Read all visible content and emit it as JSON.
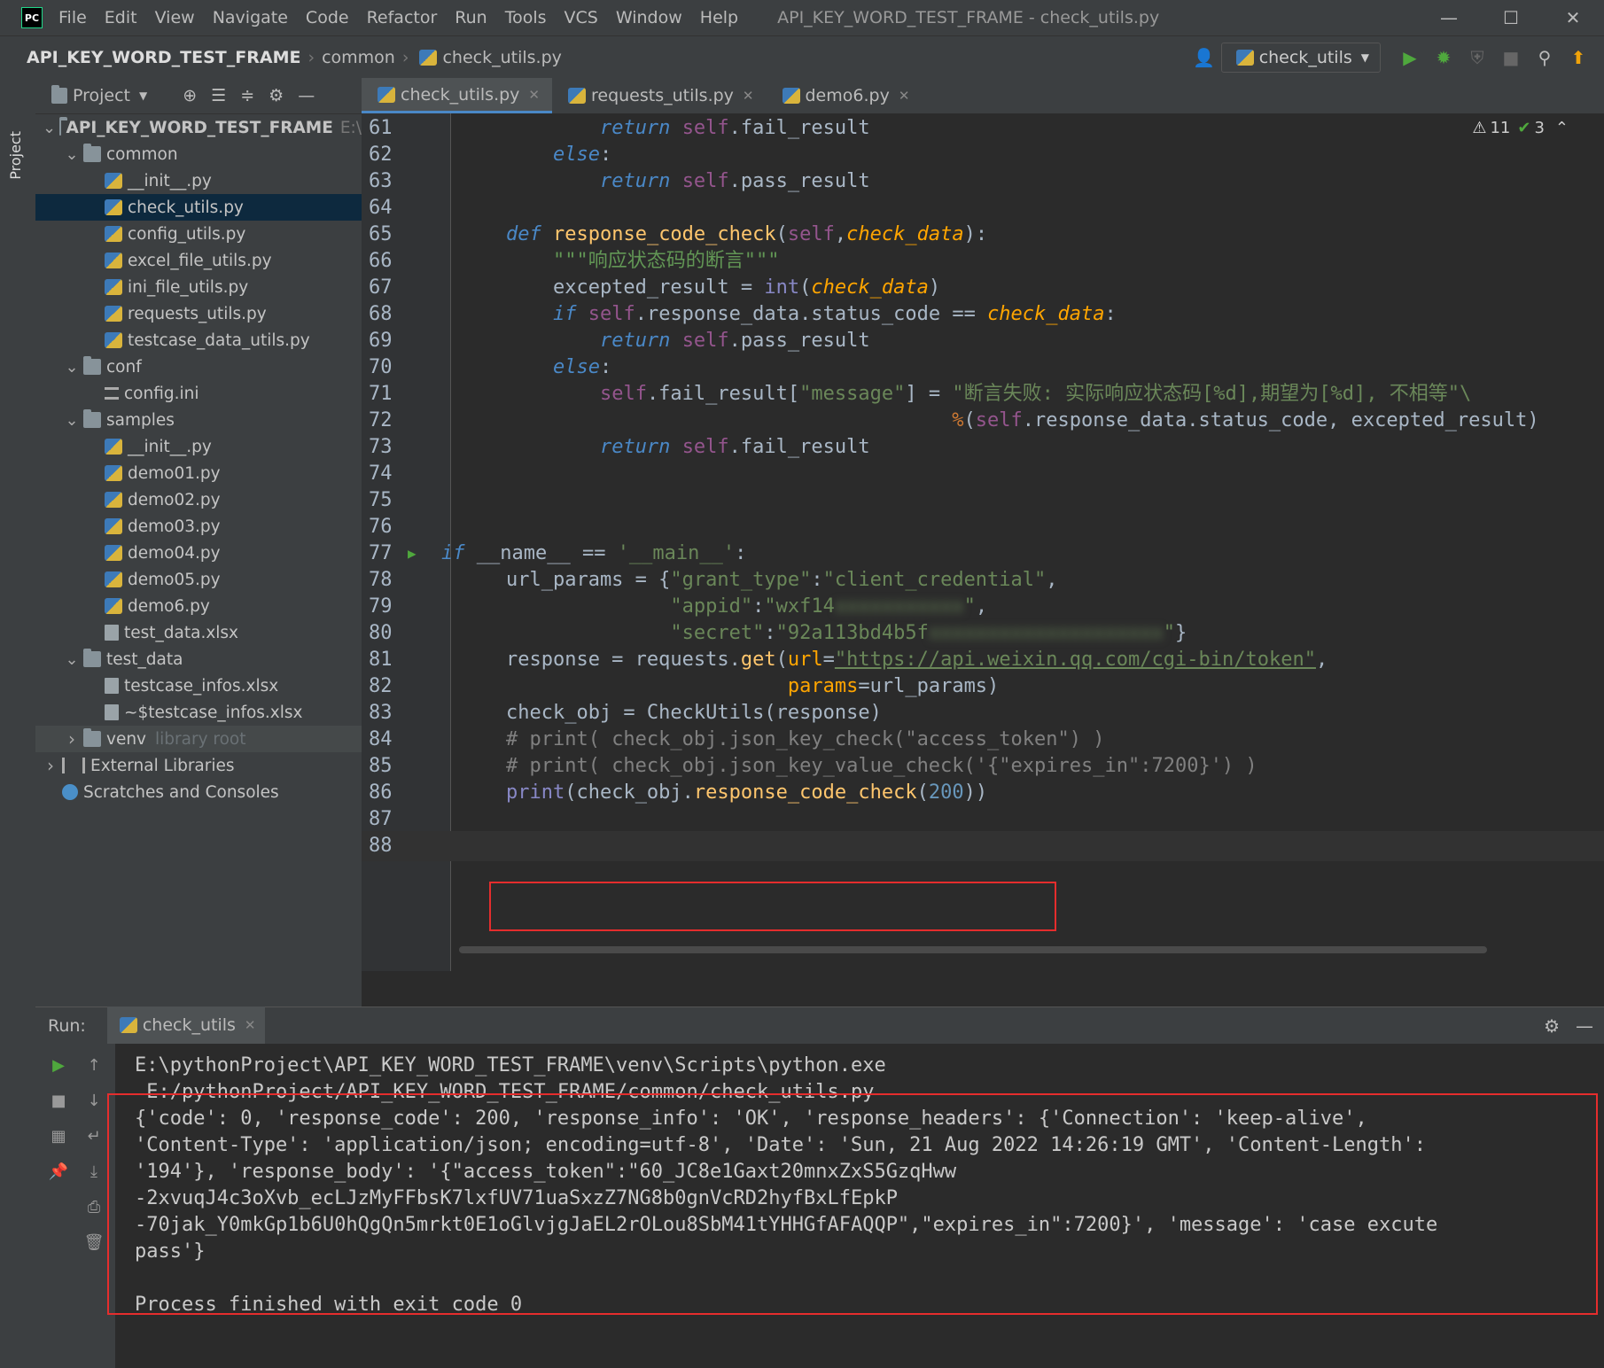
{
  "titlebar": {
    "logo": "PC",
    "menu": [
      "File",
      "Edit",
      "View",
      "Navigate",
      "Code",
      "Refactor",
      "Run",
      "Tools",
      "VCS",
      "Window",
      "Help"
    ],
    "title": "API_KEY_WORD_TEST_FRAME - check_utils.py",
    "controls": [
      "—",
      "☐",
      "✕"
    ]
  },
  "navbar": {
    "breadcrumb": [
      "API_KEY_WORD_TEST_FRAME",
      "common",
      "check_utils.py"
    ],
    "run_config": "check_utils"
  },
  "stripe": {
    "project_label": "Project"
  },
  "project_panel": {
    "title": "Project",
    "root_path_hint": "E:\\",
    "tree": [
      {
        "label": "API_KEY_WORD_TEST_FRAME",
        "type": "folder",
        "depth": 0,
        "open": true
      },
      {
        "label": "common",
        "type": "folder",
        "depth": 1,
        "open": true
      },
      {
        "label": "__init__.py",
        "type": "py",
        "depth": 2
      },
      {
        "label": "check_utils.py",
        "type": "py",
        "depth": 2,
        "selected": true
      },
      {
        "label": "config_utils.py",
        "type": "py",
        "depth": 2
      },
      {
        "label": "excel_file_utils.py",
        "type": "py",
        "depth": 2
      },
      {
        "label": "ini_file_utils.py",
        "type": "py",
        "depth": 2
      },
      {
        "label": "requests_utils.py",
        "type": "py",
        "depth": 2
      },
      {
        "label": "testcase_data_utils.py",
        "type": "py",
        "depth": 2
      },
      {
        "label": "conf",
        "type": "folder",
        "depth": 1,
        "open": true
      },
      {
        "label": "config.ini",
        "type": "ini",
        "depth": 2
      },
      {
        "label": "samples",
        "type": "folder",
        "depth": 1,
        "open": true
      },
      {
        "label": "__init__.py",
        "type": "py",
        "depth": 2
      },
      {
        "label": "demo01.py",
        "type": "py",
        "depth": 2
      },
      {
        "label": "demo02.py",
        "type": "py",
        "depth": 2
      },
      {
        "label": "demo03.py",
        "type": "py",
        "depth": 2
      },
      {
        "label": "demo04.py",
        "type": "py",
        "depth": 2
      },
      {
        "label": "demo05.py",
        "type": "py",
        "depth": 2
      },
      {
        "label": "demo6.py",
        "type": "py",
        "depth": 2
      },
      {
        "label": "test_data.xlsx",
        "type": "xls",
        "depth": 2
      },
      {
        "label": "test_data",
        "type": "folder",
        "depth": 1,
        "open": true
      },
      {
        "label": "testcase_infos.xlsx",
        "type": "xls",
        "depth": 2
      },
      {
        "label": "~$testcase_infos.xlsx",
        "type": "xls",
        "depth": 2
      },
      {
        "label": "venv",
        "type": "folder",
        "depth": 1,
        "open": false,
        "extra": "library root",
        "hl": true
      },
      {
        "label": "External Libraries",
        "type": "lib",
        "depth": 0,
        "open": false
      },
      {
        "label": "Scratches and Consoles",
        "type": "scratch",
        "depth": 0
      }
    ]
  },
  "tabs": [
    {
      "label": "check_utils.py",
      "active": true
    },
    {
      "label": "requests_utils.py",
      "active": false
    },
    {
      "label": "demo6.py",
      "active": false
    }
  ],
  "editor": {
    "warnings": "11",
    "checks": "3"
  },
  "run_panel": {
    "label": "Run:",
    "tab": "check_utils",
    "console": [
      "E:\\pythonProject\\API_KEY_WORD_TEST_FRAME\\venv\\Scripts\\python.exe",
      " E:/pythonProject/API_KEY_WORD_TEST_FRAME/common/check_utils.py",
      "{'code': 0, 'response_code': 200, 'response_info': 'OK', 'response_headers': {'Connection': 'keep-alive', ",
      "'Content-Type': 'application/json; encoding=utf-8', 'Date': 'Sun, 21 Aug 2022 14:26:19 GMT', 'Content-Length': ",
      "'194'}, 'response_body': '{\"access_token\":\"60_JC8e1Gaxt20mnxZxS5GzqHww",
      "-2xvuqJ4c3oXvb_ecLJzMyFFbsK7lxfUV71uaSxzZ7NG8b0gnVcRD2hyfBxLfEpkP",
      "-70jak_Y0mkGp1b6U0hQgQn5mrkt0E1oGlvjgJaEL2rOLou8SbM41tYHHGfAFAQQP\",\"expires_in\":7200}', 'message': 'case excute ",
      "pass'}",
      "",
      "Process finished with exit code 0"
    ]
  }
}
